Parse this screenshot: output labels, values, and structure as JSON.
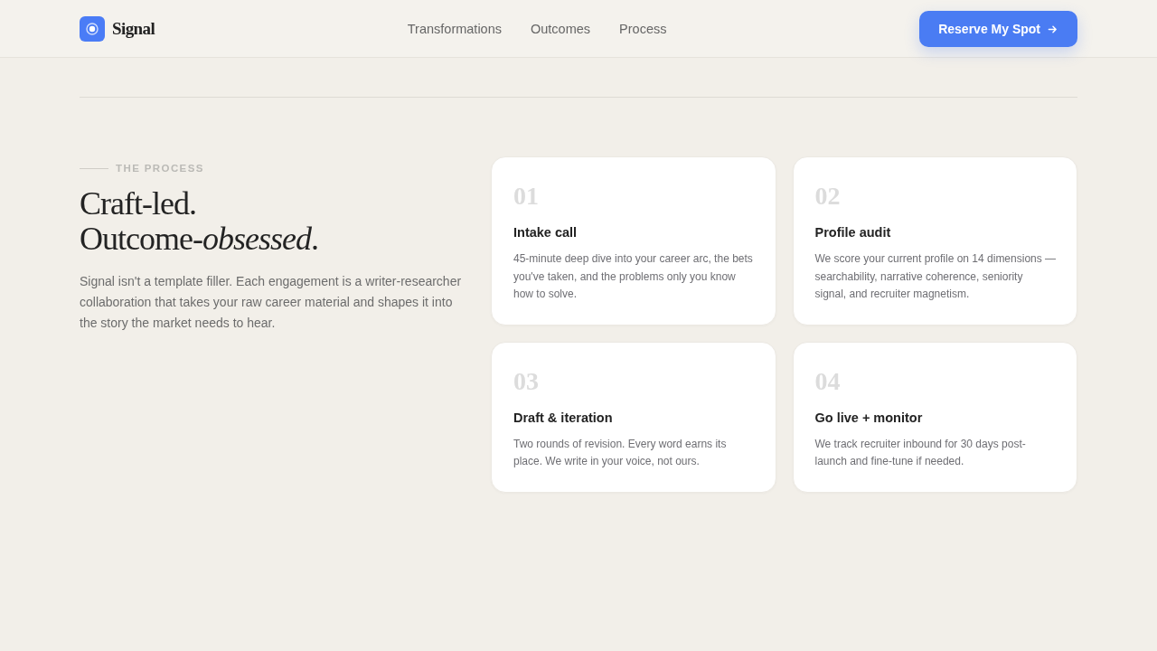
{
  "header": {
    "brand": "Signal",
    "nav": [
      {
        "label": "Transformations"
      },
      {
        "label": "Outcomes"
      },
      {
        "label": "Process"
      }
    ],
    "cta": {
      "label": "Reserve My Spot"
    }
  },
  "process": {
    "eyebrow": "THE PROCESS",
    "heading_lines": [
      "Craft-led.",
      "Outcome-*obsessed*."
    ],
    "intro": "Signal isn't a template filler. Each engagement is a writer-researcher collaboration that takes your raw career material and shapes it into the story the market needs to hear.",
    "steps": [
      {
        "number": "01",
        "title": "Intake call",
        "description": "45-minute deep dive into your career arc, the bets you've taken, and the problems only you know how to solve."
      },
      {
        "number": "02",
        "title": "Profile audit",
        "description": "We score your current profile on 14 dimensions — searchability, narrative coherence, seniority signal, and recruiter magnetism."
      },
      {
        "number": "03",
        "title": "Draft & iteration",
        "description": "Two rounds of revision. Every word earns its place. We write in your voice, not ours."
      },
      {
        "number": "04",
        "title": "Go live + monitor",
        "description": "We track recruiter inbound for 30 days post-launch and fine-tune if needed."
      }
    ]
  }
}
